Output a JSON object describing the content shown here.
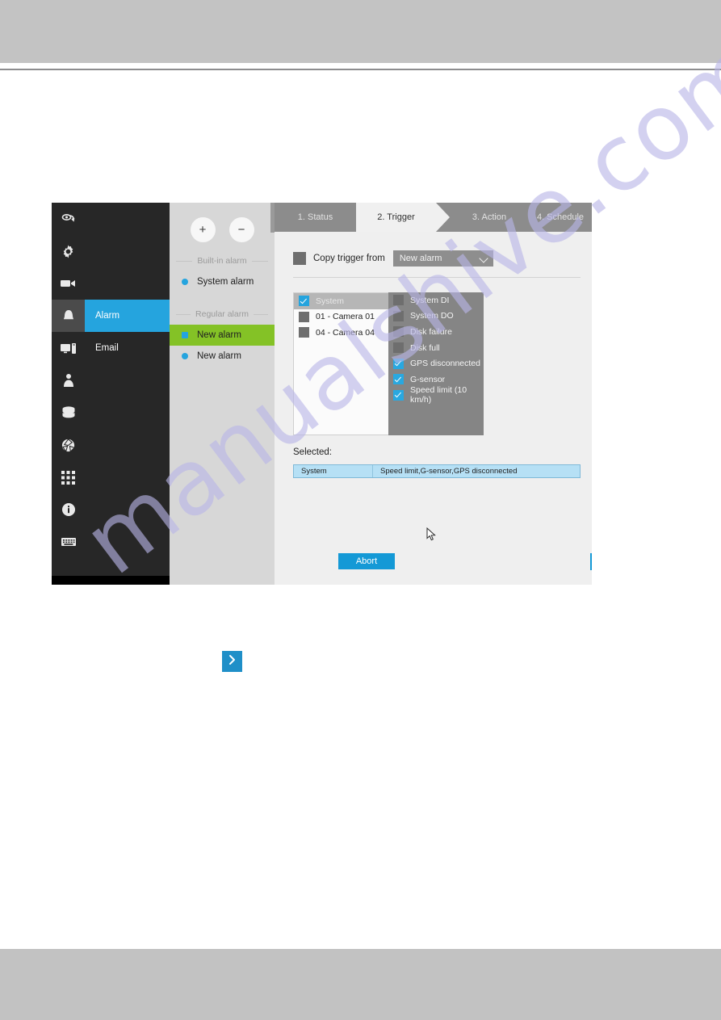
{
  "app": {
    "rail": {
      "items": [
        {
          "name": "live-view-icon",
          "label": "Live view"
        },
        {
          "name": "settings-gear-icon",
          "label": "Settings"
        },
        {
          "name": "camera-icon",
          "label": "Camera"
        },
        {
          "name": "alarm-bell-icon",
          "label": "Alarm"
        },
        {
          "name": "display-icon",
          "label": "Display"
        },
        {
          "name": "user-icon",
          "label": "User"
        },
        {
          "name": "storage-icon",
          "label": "Storage"
        },
        {
          "name": "network-globe-icon",
          "label": "Network"
        },
        {
          "name": "apps-grid-icon",
          "label": "Applications"
        },
        {
          "name": "info-icon",
          "label": "Information"
        },
        {
          "name": "keyboard-icon",
          "label": "Keyboard"
        }
      ]
    },
    "menu": {
      "items": [
        {
          "label": "Alarm",
          "active": true
        },
        {
          "label": "Email",
          "active": false
        }
      ]
    },
    "alarm_panel": {
      "add_label": "+",
      "remove_label": "−",
      "groups": [
        {
          "title": "Built-in alarm",
          "items": [
            {
              "label": "System alarm",
              "selected": false
            }
          ]
        },
        {
          "title": "Regular alarm",
          "items": [
            {
              "label": "New alarm",
              "selected": true
            },
            {
              "label": "New alarm",
              "selected": false
            }
          ]
        }
      ]
    },
    "wizard": {
      "tabs": [
        {
          "label": "1. Status",
          "active": false
        },
        {
          "label": "2. Trigger",
          "active": true
        },
        {
          "label": "3. Action",
          "active": false
        },
        {
          "label": "4. Schedule",
          "active": false
        }
      ],
      "copy_trigger": {
        "checkbox_checked": false,
        "label": "Copy trigger from",
        "select_value": "New alarm"
      },
      "source_list": [
        {
          "label": "System",
          "checked": true,
          "highlighted": true
        },
        {
          "label": "01 - Camera 01",
          "checked": false,
          "highlighted": false
        },
        {
          "label": "04 - Camera 04",
          "checked": false,
          "highlighted": false
        }
      ],
      "trigger_list": [
        {
          "label": "System DI",
          "checked": false
        },
        {
          "label": "System DO",
          "checked": false
        },
        {
          "label": "Disk failure",
          "checked": false
        },
        {
          "label": "Disk full",
          "checked": false
        },
        {
          "label": "GPS disconnected",
          "checked": true
        },
        {
          "label": "G-sensor",
          "checked": true
        },
        {
          "label": "Speed limit (10 km/h)",
          "checked": true
        }
      ],
      "selected": {
        "label": "Selected:",
        "rows": [
          {
            "source": "System",
            "triggers": "Speed limit,G-sensor,GPS disconnected"
          }
        ]
      },
      "footer": {
        "abort_label": "Abort",
        "prev_label": "‹",
        "next_label": "›"
      }
    }
  },
  "watermark": {
    "text": "manualshive.com"
  },
  "colors": {
    "accent_blue": "#25a4de",
    "accent_green": "#84c226",
    "rail_dark": "#272727",
    "panel_gray": "#efefef",
    "tab_gray": "#8c8c8c",
    "list_gray": "#858585",
    "selected_row_blue": "#b6e0f5"
  }
}
